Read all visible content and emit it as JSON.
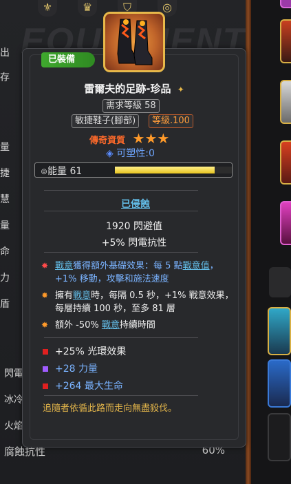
{
  "background": {
    "watermark": "EQUIPMENT",
    "left_stats": [
      "出",
      "存",
      "量",
      "捷",
      "慧",
      "量",
      "命",
      "力",
      "盾"
    ],
    "tags": [
      "閃電",
      "冰冷",
      "火焰"
    ],
    "bottom_stat": {
      "label": "腐蝕抗性",
      "value": "60%"
    }
  },
  "tooltip": {
    "equipped_badge": "已裝備",
    "item_name": "雷爾夫的足跡-珍品",
    "required_level": "需求等級 58",
    "item_type": "敏捷鞋子(腳部)",
    "item_level": "等級.100",
    "rarity_label": "傳奇資質",
    "stars": 3,
    "plasticity": "可塑性:0",
    "energy": {
      "label": "能量 61",
      "fraction": 0.85
    },
    "corroded_label": "已侵蝕",
    "main_stats": [
      "1920 閃避值",
      "+5% 閃電抗性"
    ],
    "effects": [
      {
        "parts": [
          {
            "t": "戰意",
            "link": true
          },
          {
            "t": "獲得額外基礎效果：每 5 點"
          },
          {
            "t": "戰意值",
            "link": true
          },
          {
            "t": "，+1% 移動，攻擊和施法速度"
          }
        ],
        "color": "#7ab3ff",
        "bullet": "#ff4a4a"
      },
      {
        "parts": [
          {
            "t": "擁有"
          },
          {
            "t": "戰意",
            "link": true
          },
          {
            "t": "時，每隔 0.5 秒，+1% 戰意效果，每層持續 100 秒，至多 81 層"
          }
        ],
        "color": "#efefef",
        "bullet": "#ff9a2a"
      },
      {
        "parts": [
          {
            "t": "額外 -50% "
          },
          {
            "t": "戰意",
            "link": true
          },
          {
            "t": "持續時間"
          }
        ],
        "color": "#efefef",
        "bullet": "#ff9a2a"
      }
    ],
    "sub_stats": [
      {
        "text": "+25% 光環效果",
        "color": "#efefef",
        "square": "#e02020"
      },
      {
        "text": "+28 力量",
        "color": "#7ab3ff",
        "square": "#a05cff"
      },
      {
        "text": "+264 最大生命",
        "color": "#7ab3ff",
        "square": "#e02020"
      }
    ],
    "flavor_text": "追隨者依循此路而走向無盡殺伐。"
  },
  "colors": {
    "accent_gold": "#e8b94a",
    "link_blue": "#63bde8",
    "equipped_green": "#3fa82e"
  }
}
